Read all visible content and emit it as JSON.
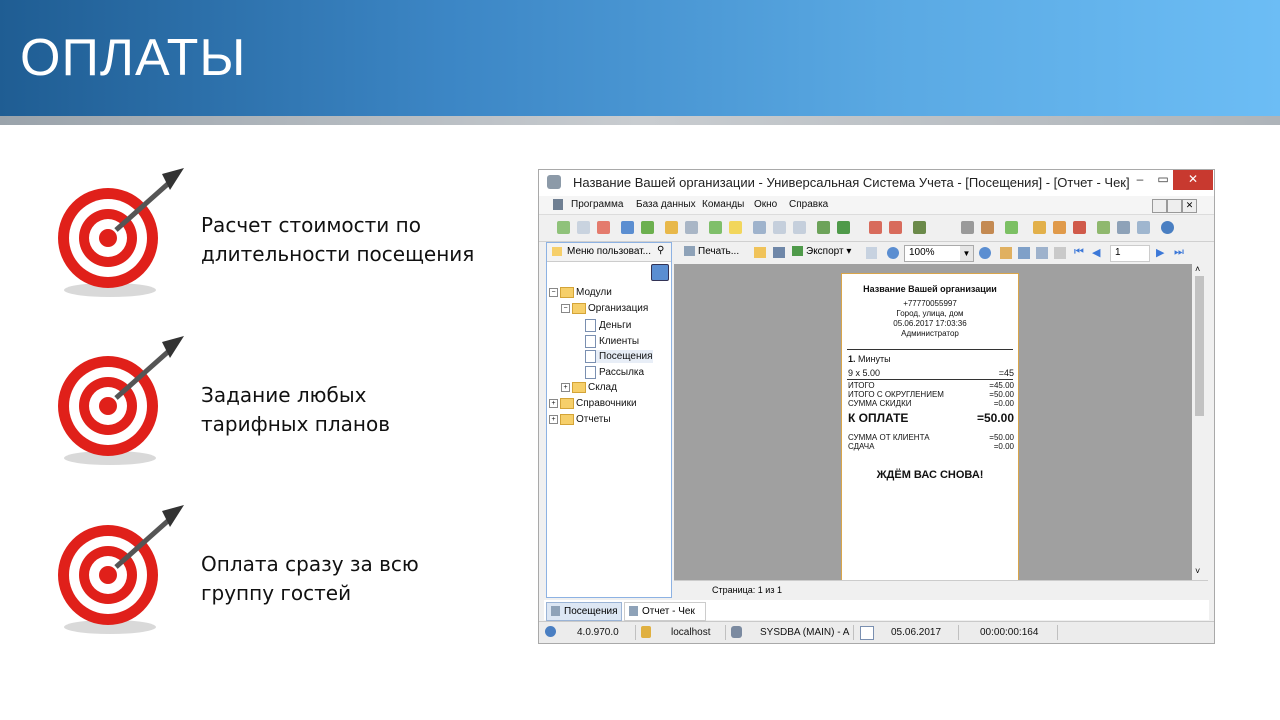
{
  "slide": {
    "title": "ОПЛАТЫ",
    "features": [
      {
        "icon": "target-icon",
        "line1": "Расчет стоимости по",
        "line2": "длительности посещения"
      },
      {
        "icon": "target-icon",
        "line1": "Задание любых",
        "line2": "тарифных планов"
      },
      {
        "icon": "target-icon",
        "line1": "Оплата сразу за всю",
        "line2": "группу гостей"
      }
    ]
  },
  "window": {
    "title": "Название Вашей организации - Универсальная Система Учета - [Посещения] - [Отчет - Чек]",
    "menu": [
      "Программа",
      "База данных",
      "Команды",
      "Окно",
      "Справка"
    ],
    "left_panel": {
      "header": "Меню пользоват...",
      "tree": {
        "root": "Модули",
        "org": "Организация",
        "money": "Деньги",
        "clients": "Клиенты",
        "visits": "Посещения",
        "mailing": "Рассылка",
        "stock": "Склад",
        "refs": "Справочники",
        "reports": "Отчеты"
      }
    },
    "report_toolbar": {
      "print": "Печать...",
      "export": "Экспорт",
      "zoom": "100%",
      "page": "1"
    },
    "receipt": {
      "org": "Название Вашей организации",
      "phone": "+77770055997",
      "address": "Город, улица, дом",
      "datetime": "05.06.2017 17:03:36",
      "operator": "Администратор",
      "item_num": "1.",
      "item_name": "Минуты",
      "calc": "9 x 5.00",
      "calc_sum": "=45",
      "total_label": "ИТОГО",
      "total_value": "=45.00",
      "rounded_label": "ИТОГО С ОКРУГЛЕНИЕМ",
      "rounded_value": "=50.00",
      "discount_label": "СУММА СКИДКИ",
      "discount_value": "=0.00",
      "pay_label": "К ОПЛАТЕ",
      "pay_value": "=50.00",
      "client_label": "СУММА ОТ КЛИЕНТА",
      "client_value": "=50.00",
      "change_label": "СДАЧА",
      "change_value": "=0.00",
      "footer": "ЖДЁМ ВАС СНОВА!"
    },
    "page_status": "Страница: 1 из 1",
    "tabs": [
      "Посещения",
      "Отчет - Чек"
    ],
    "status": {
      "version": "4.0.970.0",
      "host": "localhost",
      "user": "SYSDBA (MAIN) - A",
      "date": "05.06.2017",
      "time": "00:00:00:164"
    }
  }
}
